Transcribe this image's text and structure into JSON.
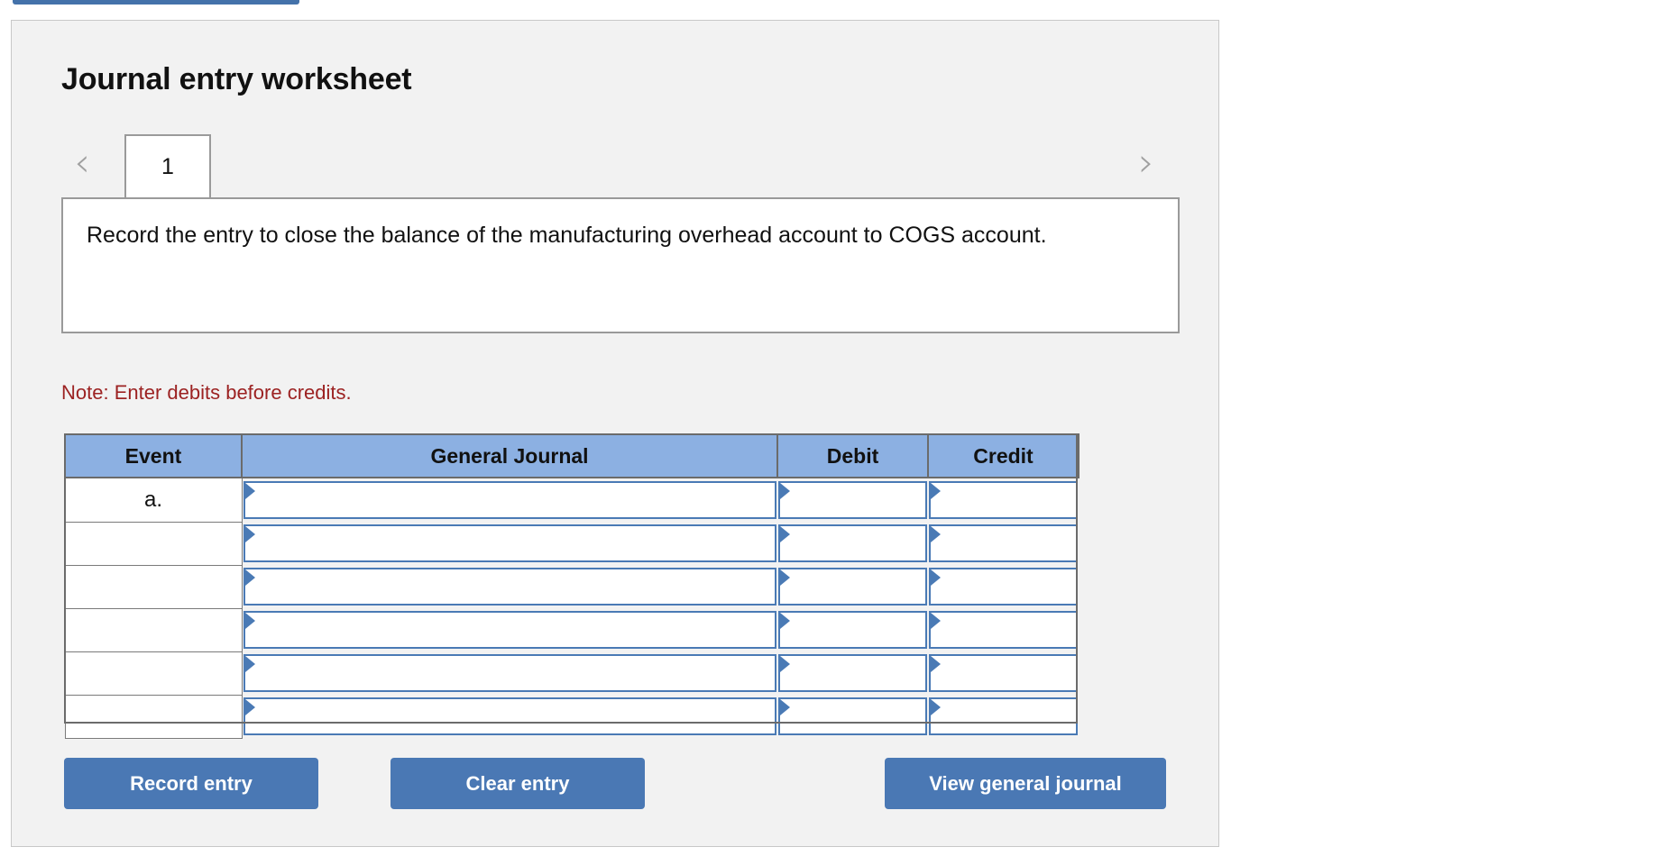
{
  "top_strip": {
    "color": "#4472aa"
  },
  "panel": {
    "title": "Journal entry worksheet",
    "background": "#f2f2f2",
    "border_color": "#c8c8c8"
  },
  "tabs": {
    "prev_icon": "chevron-left-icon",
    "prev_glyph": "‹",
    "next_icon": "chevron-right-icon",
    "next_glyph": "›",
    "items": [
      {
        "label": "1",
        "active": true
      }
    ]
  },
  "description": {
    "text": "Record the entry to close the balance of the manufacturing overhead account to COGS account."
  },
  "note": {
    "text": "Note: Enter debits before credits.",
    "color": "#9c2222"
  },
  "table": {
    "header_background": "#8cb0e2",
    "columns": [
      "Event",
      "General Journal",
      "Debit",
      "Credit"
    ],
    "rows": [
      {
        "event": "a.",
        "general_journal": "",
        "debit": "",
        "credit": ""
      },
      {
        "event": "",
        "general_journal": "",
        "debit": "",
        "credit": ""
      },
      {
        "event": "",
        "general_journal": "",
        "debit": "",
        "credit": ""
      },
      {
        "event": "",
        "general_journal": "",
        "debit": "",
        "credit": ""
      },
      {
        "event": "",
        "general_journal": "",
        "debit": "",
        "credit": ""
      },
      {
        "event": "",
        "general_journal": "",
        "debit": "",
        "credit": ""
      }
    ]
  },
  "buttons": {
    "record": "Record entry",
    "clear": "Clear entry",
    "view": "View general journal",
    "color": "#4a78b4"
  }
}
